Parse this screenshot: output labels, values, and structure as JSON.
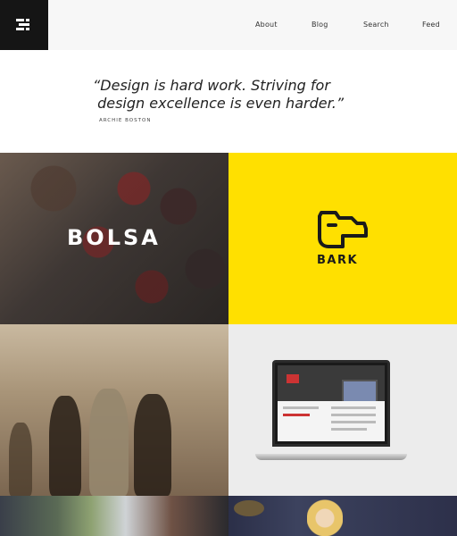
{
  "header": {
    "nav": [
      "About",
      "Blog",
      "Search",
      "Feed"
    ]
  },
  "quote": {
    "text": "“Design is hard work. Striving for\n design excellence is even harder.”",
    "author": "Archie Boston"
  },
  "tiles": {
    "bolsa_word": "BOLSA",
    "bark_word": "BARK"
  },
  "colors": {
    "header_bg": "#f7f7f7",
    "logo_bg": "#151515",
    "bark_yellow": "#ffe000",
    "laptop_bg": "#ececec"
  },
  "icons": {
    "logo": "menu-lines-icon",
    "bark": "dog-head-icon"
  }
}
